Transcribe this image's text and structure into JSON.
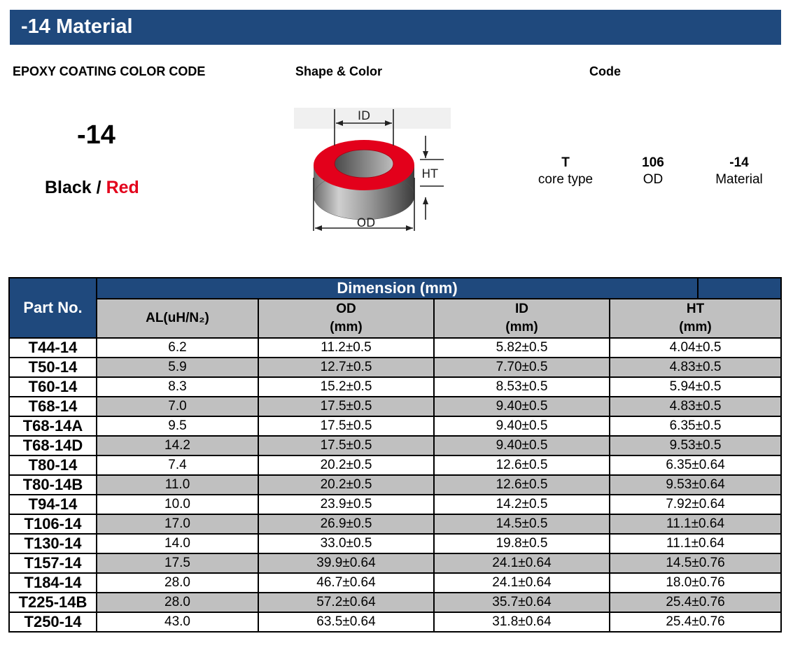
{
  "title": "-14 Material",
  "headers": {
    "epoxy": "EPOXY COATING COLOR CODE",
    "shape": "Shape & Color",
    "code": "Code"
  },
  "material_code": "-14",
  "color_code": {
    "primary": "Black",
    "separator": " / ",
    "secondary": "Red"
  },
  "diagram_labels": {
    "id": "ID",
    "ht": "HT",
    "od": "OD"
  },
  "code_breakdown": [
    {
      "value": "T",
      "label": "core type"
    },
    {
      "value": "106",
      "label": "OD"
    },
    {
      "value": "-14",
      "label": "Material"
    }
  ],
  "table": {
    "part_no_header": "Part No.",
    "dimension_header": "Dimension (mm)",
    "columns": [
      {
        "name": "AL(uH/N₂)",
        "unit": ""
      },
      {
        "name": "OD",
        "unit": "(mm)"
      },
      {
        "name": "ID",
        "unit": "(mm)"
      },
      {
        "name": "HT",
        "unit": "(mm)"
      }
    ],
    "rows": [
      {
        "part": "T44-14",
        "al": "6.2",
        "od": "11.2±0.5",
        "id": "5.82±0.5",
        "ht": "4.04±0.5"
      },
      {
        "part": "T50-14",
        "al": "5.9",
        "od": "12.7±0.5",
        "id": "7.70±0.5",
        "ht": "4.83±0.5"
      },
      {
        "part": "T60-14",
        "al": "8.3",
        "od": "15.2±0.5",
        "id": "8.53±0.5",
        "ht": "5.94±0.5"
      },
      {
        "part": "T68-14",
        "al": "7.0",
        "od": "17.5±0.5",
        "id": "9.40±0.5",
        "ht": "4.83±0.5"
      },
      {
        "part": "T68-14A",
        "al": "9.5",
        "od": "17.5±0.5",
        "id": "9.40±0.5",
        "ht": "6.35±0.5"
      },
      {
        "part": "T68-14D",
        "al": "14.2",
        "od": "17.5±0.5",
        "id": "9.40±0.5",
        "ht": "9.53±0.5"
      },
      {
        "part": "T80-14",
        "al": "7.4",
        "od": "20.2±0.5",
        "id": "12.6±0.5",
        "ht": "6.35±0.64"
      },
      {
        "part": "T80-14B",
        "al": "11.0",
        "od": "20.2±0.5",
        "id": "12.6±0.5",
        "ht": "9.53±0.64"
      },
      {
        "part": "T94-14",
        "al": "10.0",
        "od": "23.9±0.5",
        "id": "14.2±0.5",
        "ht": "7.92±0.64"
      },
      {
        "part": "T106-14",
        "al": "17.0",
        "od": "26.9±0.5",
        "id": "14.5±0.5",
        "ht": "11.1±0.64"
      },
      {
        "part": "T130-14",
        "al": "14.0",
        "od": "33.0±0.5",
        "id": "19.8±0.5",
        "ht": "11.1±0.64"
      },
      {
        "part": "T157-14",
        "al": "17.5",
        "od": "39.9±0.64",
        "id": "24.1±0.64",
        "ht": "14.5±0.76"
      },
      {
        "part": "T184-14",
        "al": "28.0",
        "od": "46.7±0.64",
        "id": "24.1±0.64",
        "ht": "18.0±0.76"
      },
      {
        "part": "T225-14B",
        "al": "28.0",
        "od": "57.2±0.64",
        "id": "35.7±0.64",
        "ht": "25.4±0.76"
      },
      {
        "part": "T250-14",
        "al": "43.0",
        "od": "63.5±0.64",
        "id": "31.8±0.64",
        "ht": "25.4±0.76"
      }
    ]
  },
  "colors": {
    "header_blue": "#1f497d",
    "row_gray": "#c0c0c0",
    "coating_red": "#e3001b"
  }
}
